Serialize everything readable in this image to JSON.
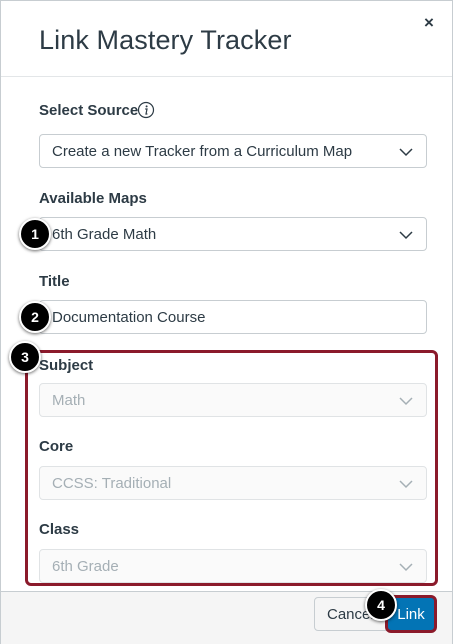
{
  "dialog": {
    "title": "Link Mastery Tracker",
    "close_label": "×"
  },
  "fields": {
    "select_source": {
      "label": "Select Source",
      "value": "Create a new Tracker from a Curriculum Map"
    },
    "available_maps": {
      "label": "Available Maps",
      "value": "6th Grade Math"
    },
    "title": {
      "label": "Title",
      "value": "Documentation Course"
    },
    "subject": {
      "label": "Subject",
      "value": "Math"
    },
    "core": {
      "label": "Core",
      "value": "CCSS: Traditional"
    },
    "class": {
      "label": "Class",
      "value": "6th Grade"
    }
  },
  "footer": {
    "cancel_label": "Cancel",
    "link_label": "Link"
  },
  "callouts": [
    "1",
    "2",
    "3",
    "4"
  ],
  "colors": {
    "primary": "#0374b5",
    "highlight": "#8b1a2b",
    "text": "#2d3b45",
    "disabled_text": "#a5afb5"
  }
}
